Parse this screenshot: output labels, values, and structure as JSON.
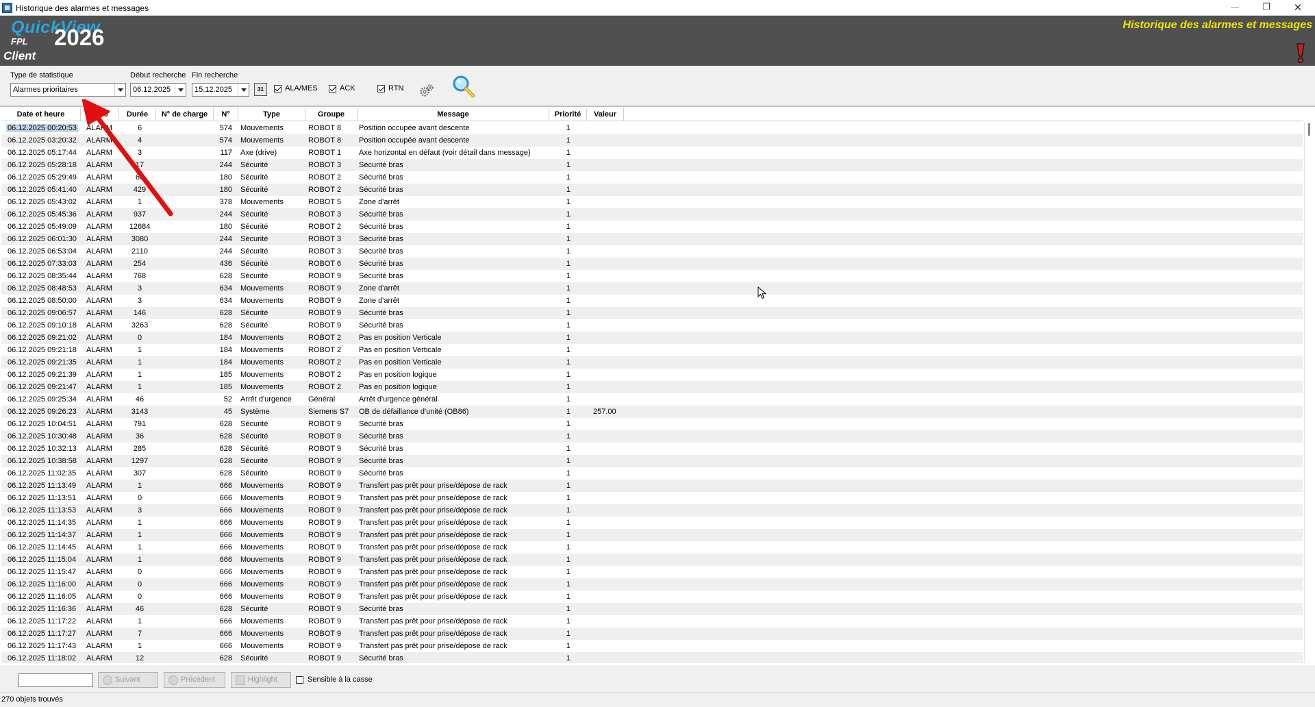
{
  "window": {
    "title": "Historique des alarmes et messages",
    "min_symbol": "—",
    "max_symbol": "❐",
    "close_symbol": "✕"
  },
  "banner": {
    "logo": "QuickView",
    "sub": "FPL",
    "year": "2026",
    "client": "Client",
    "title": "Historique des alarmes et messages",
    "title_color": "#f2e600"
  },
  "filters": {
    "stat_type_label": "Type de statistique",
    "stat_type_value": "Alarmes prioritaires",
    "start_label": "Début recherche",
    "start_value": "06.12.2025",
    "end_label": "Fin recherche",
    "end_value": "15.12.2025",
    "calendar_label": "31",
    "checkboxes": [
      {
        "label": "ALA/MES",
        "checked": true
      },
      {
        "label": "ACK",
        "checked": true
      },
      {
        "label": "RTN",
        "checked": true
      }
    ],
    "icons": [
      "settings-gears-icon",
      "search-magnifier-icon"
    ]
  },
  "table": {
    "headers": [
      "Date et heure",
      "Type",
      "Durée",
      "N° de charge",
      "N°",
      "Type",
      "Groupe",
      "Message",
      "Priorité",
      "Valeur"
    ],
    "rows": [
      [
        "06.12.2025 00:20:53",
        "ALARM",
        "6",
        "",
        "574",
        "Mouvements",
        "ROBOT 8",
        "Position occupée avant descente",
        "1",
        ""
      ],
      [
        "06.12.2025 03:20:32",
        "ALARM",
        "4",
        "",
        "574",
        "Mouvements",
        "ROBOT 8",
        "Position occupée avant descente",
        "1",
        ""
      ],
      [
        "06.12.2025 05:17:44",
        "ALARM",
        "3",
        "",
        "117",
        "Axe (drive)",
        "ROBOT 1",
        "Axe horizontal en défaut (voir détail dans message)",
        "1",
        ""
      ],
      [
        "06.12.2025 05:28:18",
        "ALARM",
        "17",
        "",
        "244",
        "Sécurité",
        "ROBOT 3",
        "Sécurité bras",
        "1",
        ""
      ],
      [
        "06.12.2025 05:29:49",
        "ALARM",
        "68",
        "",
        "180",
        "Sécurité",
        "ROBOT 2",
        "Sécurité bras",
        "1",
        ""
      ],
      [
        "06.12.2025 05:41:40",
        "ALARM",
        "429",
        "",
        "180",
        "Sécurité",
        "ROBOT 2",
        "Sécurité bras",
        "1",
        ""
      ],
      [
        "06.12.2025 05:43:02",
        "ALARM",
        "1",
        "",
        "378",
        "Mouvements",
        "ROBOT 5",
        "Zone d'arrêt",
        "1",
        ""
      ],
      [
        "06.12.2025 05:45:36",
        "ALARM",
        "937",
        "",
        "244",
        "Sécurité",
        "ROBOT 3",
        "Sécurité bras",
        "1",
        ""
      ],
      [
        "06.12.2025 05:49:09",
        "ALARM",
        "12684",
        "",
        "180",
        "Sécurité",
        "ROBOT 2",
        "Sécurité bras",
        "1",
        ""
      ],
      [
        "06.12.2025 06:01:30",
        "ALARM",
        "3080",
        "",
        "244",
        "Sécurité",
        "ROBOT 3",
        "Sécurité bras",
        "1",
        ""
      ],
      [
        "06.12.2025 06:53:04",
        "ALARM",
        "2110",
        "",
        "244",
        "Sécurité",
        "ROBOT 3",
        "Sécurité bras",
        "1",
        ""
      ],
      [
        "06.12.2025 07:33:03",
        "ALARM",
        "254",
        "",
        "436",
        "Sécurité",
        "ROBOT 6",
        "Sécurité bras",
        "1",
        ""
      ],
      [
        "06.12.2025 08:35:44",
        "ALARM",
        "768",
        "",
        "628",
        "Sécurité",
        "ROBOT 9",
        "Sécurité bras",
        "1",
        ""
      ],
      [
        "06.12.2025 08:48:53",
        "ALARM",
        "3",
        "",
        "634",
        "Mouvements",
        "ROBOT 9",
        "Zone d'arrêt",
        "1",
        ""
      ],
      [
        "06.12.2025 08:50:00",
        "ALARM",
        "3",
        "",
        "634",
        "Mouvements",
        "ROBOT 9",
        "Zone d'arrêt",
        "1",
        ""
      ],
      [
        "06.12.2025 09:06:57",
        "ALARM",
        "146",
        "",
        "628",
        "Sécurité",
        "ROBOT 9",
        "Sécurité bras",
        "1",
        ""
      ],
      [
        "06.12.2025 09:10:18",
        "ALARM",
        "3263",
        "",
        "628",
        "Sécurité",
        "ROBOT 9",
        "Sécurité bras",
        "1",
        ""
      ],
      [
        "06.12.2025 09:21:02",
        "ALARM",
        "0",
        "",
        "184",
        "Mouvements",
        "ROBOT 2",
        "Pas en position Verticale",
        "1",
        ""
      ],
      [
        "06.12.2025 09:21:18",
        "ALARM",
        "1",
        "",
        "184",
        "Mouvements",
        "ROBOT 2",
        "Pas en position Verticale",
        "1",
        ""
      ],
      [
        "06.12.2025 09:21:35",
        "ALARM",
        "1",
        "",
        "184",
        "Mouvements",
        "ROBOT 2",
        "Pas en position Verticale",
        "1",
        ""
      ],
      [
        "06.12.2025 09:21:39",
        "ALARM",
        "1",
        "",
        "185",
        "Mouvements",
        "ROBOT 2",
        "Pas en position logique",
        "1",
        ""
      ],
      [
        "06.12.2025 09:21:47",
        "ALARM",
        "1",
        "",
        "185",
        "Mouvements",
        "ROBOT 2",
        "Pas en position logique",
        "1",
        ""
      ],
      [
        "06.12.2025 09:25:34",
        "ALARM",
        "46",
        "",
        "52",
        "Arrêt d'urgence",
        "Général",
        "Arrêt d'urgence général",
        "1",
        ""
      ],
      [
        "06.12.2025 09:26:23",
        "ALARM",
        "3143",
        "",
        "45",
        "Système",
        "Siemens S7",
        "OB de défaillance d'unité (OB86)",
        "1",
        "257.00"
      ],
      [
        "06.12.2025 10:04:51",
        "ALARM",
        "791",
        "",
        "628",
        "Sécurité",
        "ROBOT 9",
        "Sécurité bras",
        "1",
        ""
      ],
      [
        "06.12.2025 10:30:48",
        "ALARM",
        "36",
        "",
        "628",
        "Sécurité",
        "ROBOT 9",
        "Sécurité bras",
        "1",
        ""
      ],
      [
        "06.12.2025 10:32:13",
        "ALARM",
        "285",
        "",
        "628",
        "Sécurité",
        "ROBOT 9",
        "Sécurité bras",
        "1",
        ""
      ],
      [
        "06.12.2025 10:38:58",
        "ALARM",
        "1297",
        "",
        "628",
        "Sécurité",
        "ROBOT 9",
        "Sécurité bras",
        "1",
        ""
      ],
      [
        "06.12.2025 11:02:35",
        "ALARM",
        "307",
        "",
        "628",
        "Sécurité",
        "ROBOT 9",
        "Sécurité bras",
        "1",
        ""
      ],
      [
        "06.12.2025 11:13:49",
        "ALARM",
        "1",
        "",
        "666",
        "Mouvements",
        "ROBOT 9",
        "Transfert pas prêt pour prise/dépose de rack",
        "1",
        ""
      ],
      [
        "06.12.2025 11:13:51",
        "ALARM",
        "0",
        "",
        "666",
        "Mouvements",
        "ROBOT 9",
        "Transfert pas prêt pour prise/dépose de rack",
        "1",
        ""
      ],
      [
        "06.12.2025 11:13:53",
        "ALARM",
        "3",
        "",
        "666",
        "Mouvements",
        "ROBOT 9",
        "Transfert pas prêt pour prise/dépose de rack",
        "1",
        ""
      ],
      [
        "06.12.2025 11:14:35",
        "ALARM",
        "1",
        "",
        "666",
        "Mouvements",
        "ROBOT 9",
        "Transfert pas prêt pour prise/dépose de rack",
        "1",
        ""
      ],
      [
        "06.12.2025 11:14:37",
        "ALARM",
        "1",
        "",
        "666",
        "Mouvements",
        "ROBOT 9",
        "Transfert pas prêt pour prise/dépose de rack",
        "1",
        ""
      ],
      [
        "06.12.2025 11:14:45",
        "ALARM",
        "1",
        "",
        "666",
        "Mouvements",
        "ROBOT 9",
        "Transfert pas prêt pour prise/dépose de rack",
        "1",
        ""
      ],
      [
        "06.12.2025 11:15:04",
        "ALARM",
        "1",
        "",
        "666",
        "Mouvements",
        "ROBOT 9",
        "Transfert pas prêt pour prise/dépose de rack",
        "1",
        ""
      ],
      [
        "06.12.2025 11:15:47",
        "ALARM",
        "0",
        "",
        "666",
        "Mouvements",
        "ROBOT 9",
        "Transfert pas prêt pour prise/dépose de rack",
        "1",
        ""
      ],
      [
        "06.12.2025 11:16:00",
        "ALARM",
        "0",
        "",
        "666",
        "Mouvements",
        "ROBOT 9",
        "Transfert pas prêt pour prise/dépose de rack",
        "1",
        ""
      ],
      [
        "06.12.2025 11:16:05",
        "ALARM",
        "0",
        "",
        "666",
        "Mouvements",
        "ROBOT 9",
        "Transfert pas prêt pour prise/dépose de rack",
        "1",
        ""
      ],
      [
        "06.12.2025 11:16:36",
        "ALARM",
        "46",
        "",
        "628",
        "Sécurité",
        "ROBOT 9",
        "Sécurité bras",
        "1",
        ""
      ],
      [
        "06.12.2025 11:17:22",
        "ALARM",
        "1",
        "",
        "666",
        "Mouvements",
        "ROBOT 9",
        "Transfert pas prêt pour prise/dépose de rack",
        "1",
        ""
      ],
      [
        "06.12.2025 11:17:27",
        "ALARM",
        "7",
        "",
        "666",
        "Mouvements",
        "ROBOT 9",
        "Transfert pas prêt pour prise/dépose de rack",
        "1",
        ""
      ],
      [
        "06.12.2025 11:17:43",
        "ALARM",
        "1",
        "",
        "666",
        "Mouvements",
        "ROBOT 9",
        "Transfert pas prêt pour prise/dépose de rack",
        "1",
        ""
      ],
      [
        "06.12.2025 11:18:02",
        "ALARM",
        "12",
        "",
        "628",
        "Sécurité",
        "ROBOT 9",
        "Sécurité bras",
        "1",
        ""
      ]
    ]
  },
  "findbar": {
    "search_value": "",
    "next_label": "Suivant",
    "prev_label": "Précédent",
    "highlight_label": "Highlight",
    "case_label": "Sensible à la casse"
  },
  "status": {
    "text": "270 objets trouvés"
  },
  "colors": {
    "banner_bg": "#505050",
    "logo_blue": "#27a6df",
    "annotation_red": "#e01010",
    "selection": "#c4d4e8"
  }
}
